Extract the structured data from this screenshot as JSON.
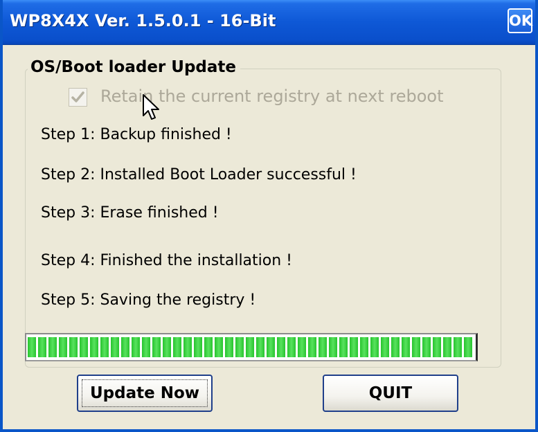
{
  "window": {
    "title": "WP8X4X Ver. 1.5.0.1 - 16-Bit",
    "ok_label": "OK"
  },
  "group": {
    "title": "OS/Boot loader Update",
    "retain_registry_label": "Retain the current registry at next reboot",
    "retain_registry_checked": true,
    "retain_registry_disabled": true
  },
  "steps": [
    "Step 1: Backup finished !",
    "Step 2: Installed Boot Loader successful !",
    "Step 3: Erase finished !",
    "Step 4: Finished the installation !",
    "Step 5: Saving the registry !"
  ],
  "progress": {
    "percent": 100,
    "color": "#2FC736"
  },
  "buttons": {
    "update_label": "Update Now",
    "quit_label": "QUIT"
  },
  "colors": {
    "titlebar": "#0E58D6",
    "window_bg": "#ECE9D8",
    "disabled_text": "#ACA899"
  }
}
